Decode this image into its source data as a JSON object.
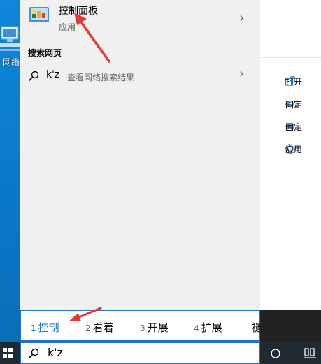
{
  "desktop": {
    "icon_label": "网络",
    "small_label": ""
  },
  "best_match": {
    "title": "控制面板",
    "subtitle": "应用",
    "icon": "control-panel-icon"
  },
  "web_section": {
    "title": "搜索网页",
    "query": "k'z",
    "description": "- 查看网络搜索结果"
  },
  "actions": [
    {
      "label": "打开",
      "icon": "open-icon"
    },
    {
      "label": "固定",
      "icon": "pin-icon"
    },
    {
      "label": "固定",
      "icon": "pin-icon"
    },
    {
      "label": "应用",
      "icon": "gear-icon"
    }
  ],
  "ime": {
    "candidates": [
      {
        "num": "1",
        "text": "控制"
      },
      {
        "num": "2",
        "text": "看着"
      },
      {
        "num": "3",
        "text": "开展"
      },
      {
        "num": "4",
        "text": "扩展"
      },
      {
        "num": "",
        "text": "褪"
      }
    ]
  },
  "search": {
    "value": "k'z"
  },
  "colors": {
    "accent": "#1a73c9",
    "arrow": "#e53935",
    "menu_bg": "#f0f0f0"
  }
}
